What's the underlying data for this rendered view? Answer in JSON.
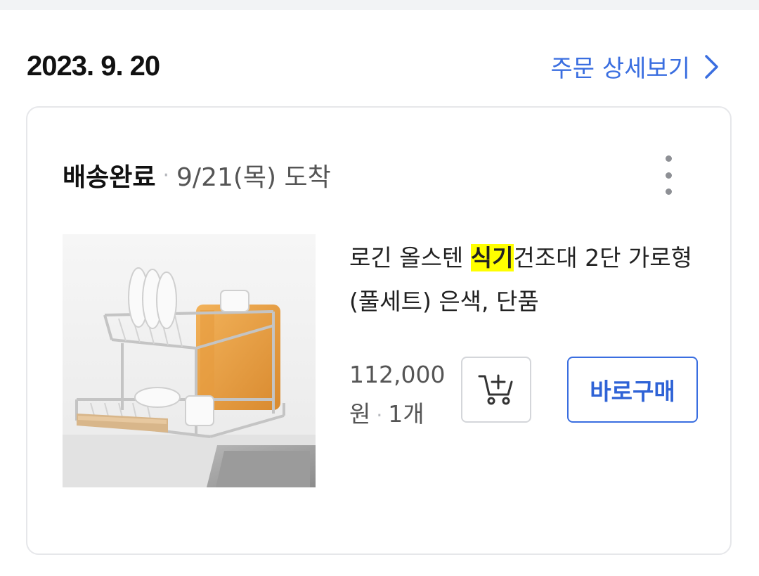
{
  "order": {
    "date": "2023. 9. 20",
    "detail_link_label": "주문 상세보기"
  },
  "delivery": {
    "status": "배송완료",
    "separator": "·",
    "arrival": "9/21(목) 도착"
  },
  "product": {
    "name_before": "로긴 올스텐 ",
    "name_highlight": "식기",
    "name_after": "건조대 2단 가로형 (풀세트) 은색, 단품",
    "price_line1": "112,000",
    "price_line2": "원",
    "separator": "·",
    "quantity": "1개"
  },
  "actions": {
    "buy_now_label": "바로구매"
  },
  "icons": {
    "detail_link": "chevron-right-icon",
    "menu": "more-vertical-icon",
    "cart": "add-to-cart-icon"
  },
  "colors": {
    "accent": "#3a6ee0",
    "highlight": "#ffff00",
    "background": "#f2f3f5",
    "card_border": "#e6e7ea"
  }
}
